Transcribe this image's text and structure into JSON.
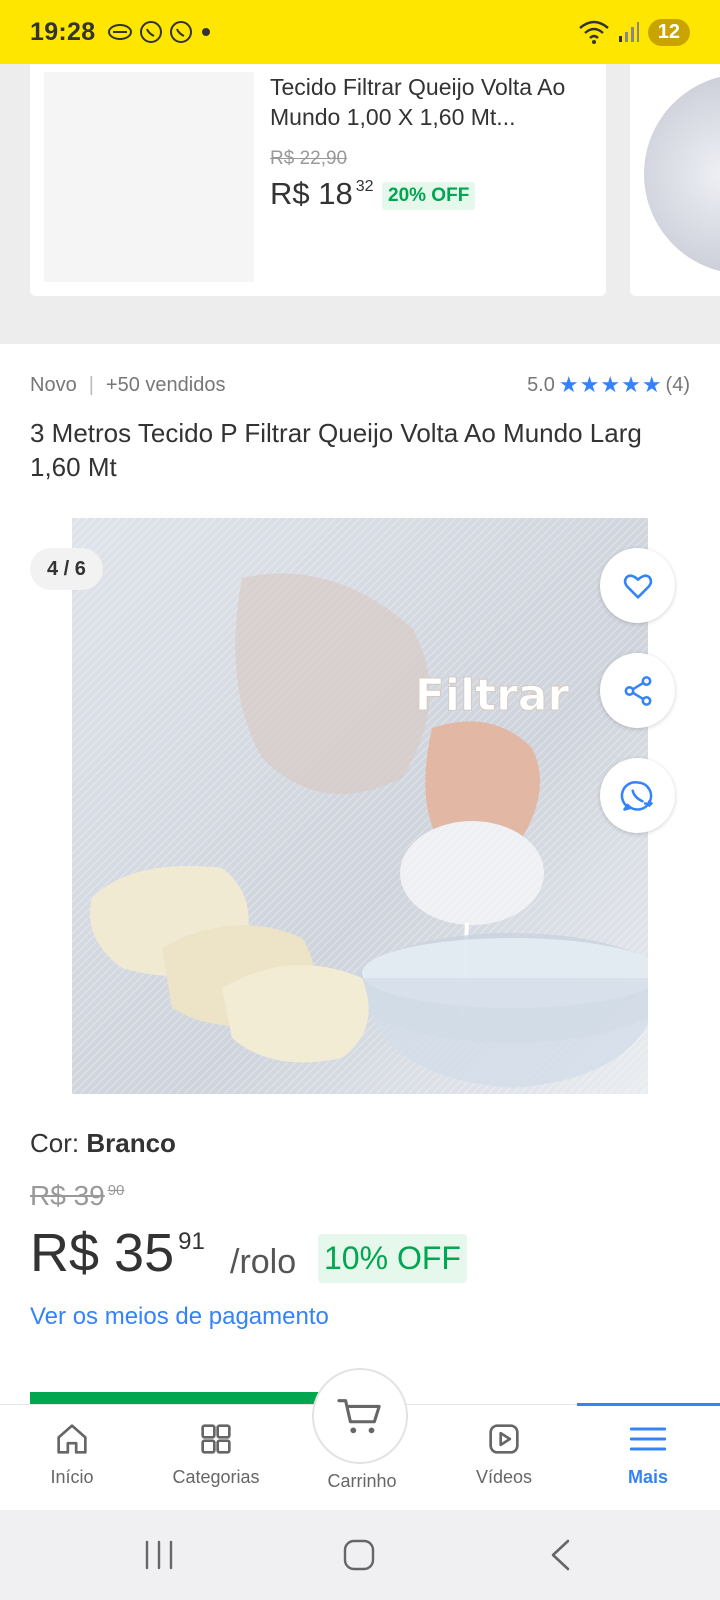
{
  "status": {
    "time": "19:28",
    "battery": "12"
  },
  "recommended": {
    "title": "Tecido Filtrar Queijo Volta Ao Mundo 1,00 X 1,60 Mt...",
    "old_price": "R$ 22,90",
    "price_main": "R$ 18",
    "price_cents": "32",
    "discount": "20% OFF"
  },
  "product": {
    "condition": "Novo",
    "sold": "+50 vendidos",
    "rating": "5.0",
    "rating_stars": 5,
    "reviews": "(4)",
    "title": "3 Metros Tecido P Filtrar Queijo Volta Ao Mundo Larg 1,60 Mt",
    "gallery_counter": "4 / 6",
    "image_caption": "Filtrar",
    "color_label": "Cor:",
    "color_value": "Branco",
    "old_price": "R$ 39",
    "old_price_cents": "90",
    "price_main": "R$ 35",
    "price_cents": "91",
    "unit": "/rolo",
    "discount": "10% OFF",
    "payment_link": "Ver os meios de pagamento"
  },
  "nav": {
    "items": [
      {
        "label": "Início",
        "icon": "home-icon"
      },
      {
        "label": "Categorias",
        "icon": "grid-icon"
      },
      {
        "label": "Carrinho",
        "icon": "cart-icon"
      },
      {
        "label": "Vídeos",
        "icon": "play-icon"
      },
      {
        "label": "Mais",
        "icon": "menu-icon"
      }
    ],
    "active": "Mais"
  },
  "colors": {
    "status_bar": "#ffe600",
    "accent_blue": "#3483fa",
    "discount_green": "#00a650"
  }
}
